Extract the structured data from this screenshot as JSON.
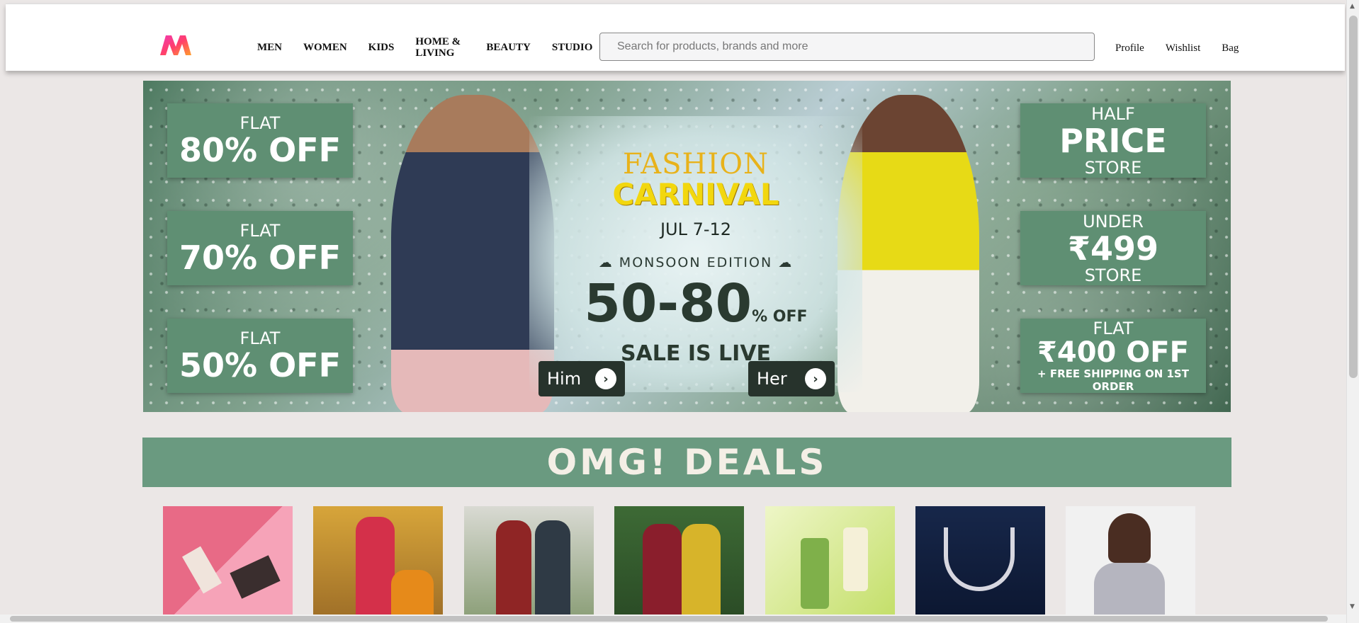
{
  "nav": {
    "items": [
      "MEN",
      "WOMEN",
      "KIDS",
      "HOME & LIVING",
      "BEAUTY",
      "STUDIO"
    ]
  },
  "search": {
    "placeholder": "Search for products, brands and more"
  },
  "header_links": [
    "Profile",
    "Wishlist",
    "Bag"
  ],
  "hero": {
    "left_offers": [
      {
        "line1": "FLAT",
        "line2": "80% OFF"
      },
      {
        "line1": "FLAT",
        "line2": "70% OFF"
      },
      {
        "line1": "FLAT",
        "line2": "50% OFF"
      }
    ],
    "right_offers": [
      {
        "line1": "HALF",
        "line2": "PRICE",
        "line3": "STORE"
      },
      {
        "line1": "UNDER",
        "line2": "₹499",
        "line3": "STORE"
      },
      {
        "line1": "FLAT",
        "line2": "₹400 OFF",
        "line3": "+ FREE SHIPPING ON 1ST ORDER"
      }
    ],
    "title1": "FASHION",
    "title2": "CARNIVAL",
    "dates": "JUL 7-12",
    "edition": "MONSOON EDITION",
    "discount": "50-80",
    "discount_suffix": "% OFF",
    "sale_text": "SALE IS LIVE",
    "him_label": "Him",
    "her_label": "Her"
  },
  "deals": {
    "title": "OMG! DEALS"
  },
  "colors": {
    "brand_pink": "#ff3f6c",
    "brand_orange": "#f13ab1",
    "offer_green": "#5f8f73",
    "deals_green": "#6a9a80"
  }
}
